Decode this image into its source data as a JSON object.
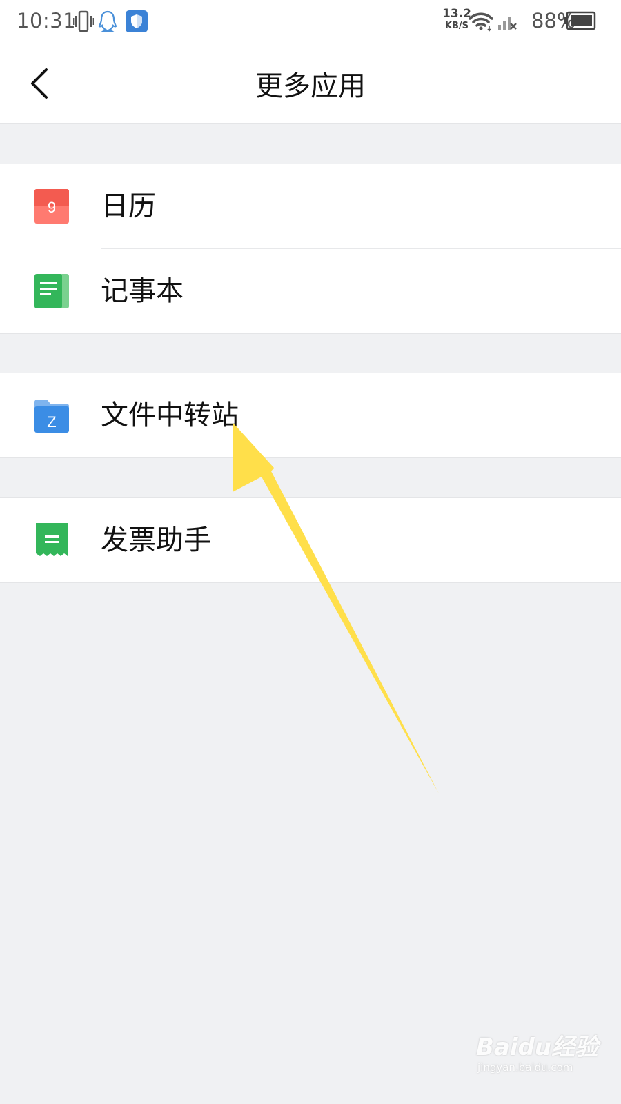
{
  "status_bar": {
    "time": "10:31",
    "net_speed_value": "13.2",
    "net_speed_unit": "KB/S",
    "battery": "88%",
    "icons": [
      "vibrate-icon",
      "qq-icon",
      "shield-icon",
      "wifi-icon",
      "cell-signal-icon",
      "battery-icon"
    ]
  },
  "header": {
    "title": "更多应用",
    "back_icon": "chevron-left-icon"
  },
  "groups": [
    {
      "items": [
        {
          "label": "日历",
          "icon": "calendar-icon",
          "icon_text": "9",
          "color": "#f35b50"
        },
        {
          "label": "记事本",
          "icon": "notepad-icon",
          "color": "#33b65a"
        }
      ]
    },
    {
      "items": [
        {
          "label": "文件中转站",
          "icon": "folder-icon",
          "icon_text": "Z",
          "color": "#3b8de5"
        }
      ]
    },
    {
      "items": [
        {
          "label": "发票助手",
          "icon": "invoice-icon",
          "color": "#33b65a"
        }
      ]
    }
  ],
  "annotation": {
    "arrow_color": "#ffdf4a"
  },
  "watermark": {
    "main": "Baidu经验",
    "sub": "jingyan.baidu.com"
  }
}
